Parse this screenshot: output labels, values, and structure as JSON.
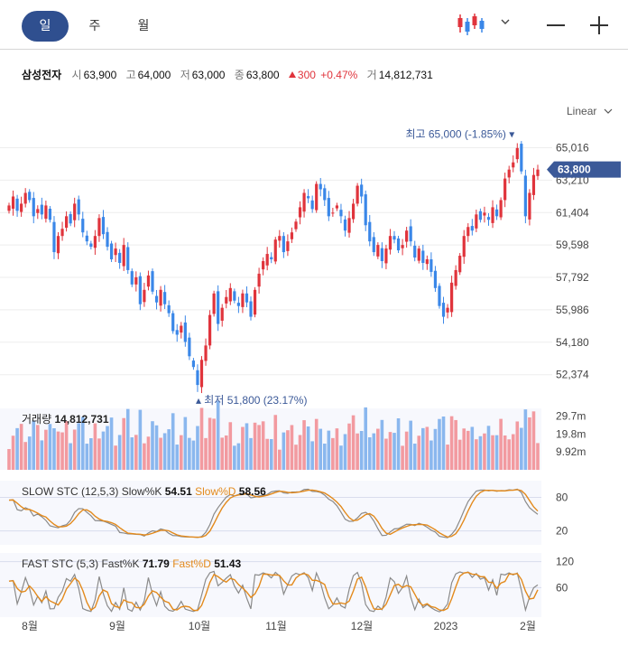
{
  "toolbar": {
    "periods": [
      "일",
      "주",
      "월"
    ],
    "active_period": "일",
    "chart_type_icon": "candlestick-icon",
    "dropdown_icon": "chevron-down-icon",
    "zoom_out_icon": "minus-icon",
    "zoom_in_icon": "plus-icon"
  },
  "info": {
    "name": "삼성전자",
    "open_label": "시",
    "open": "63,900",
    "high_label": "고",
    "high": "64,000",
    "low_label": "저",
    "low": "63,000",
    "close_label": "종",
    "close": "63,800",
    "change": "300",
    "change_pct": "+0.47%",
    "volume_label": "거",
    "volume": "14,812,731"
  },
  "scale_label": "Linear",
  "colors": {
    "up": "#e0343c",
    "down": "#3a87e8",
    "accent": "#3b5998",
    "slow_d": "#e38a1c",
    "k_line": "#8a8a8a"
  },
  "chart_data": {
    "type": "candlestick",
    "price_axis": {
      "ticks": [
        65016,
        63210,
        61404,
        59598,
        57792,
        55986,
        54180,
        52374
      ],
      "tick_labels": [
        "65,016",
        "63,210",
        "61,404",
        "59,598",
        "57,792",
        "55,986",
        "54,180",
        "52,374"
      ],
      "ylim": [
        51100,
        66200
      ]
    },
    "current_price_label": "63,800",
    "current_price": 63800,
    "high_annotation": "최고 65,000 (-1.85%)",
    "low_annotation": "최저 51,800 (23.17%)",
    "x_labels": [
      "8월",
      "9월",
      "10월",
      "11월",
      "12월",
      "2023",
      "2월"
    ],
    "closes": [
      61800,
      62300,
      61500,
      61900,
      62500,
      62100,
      61200,
      61600,
      61300,
      61800,
      61000,
      59200,
      60100,
      60500,
      61200,
      60800,
      61900,
      61300,
      60300,
      59800,
      59500,
      60100,
      61100,
      60200,
      59500,
      58800,
      59400,
      58600,
      59600,
      58200,
      57400,
      57800,
      56300,
      57100,
      57900,
      57000,
      56400,
      57100,
      56300,
      55800,
      54800,
      54600,
      55100,
      54200,
      53400,
      52800,
      51800,
      53200,
      54000,
      55700,
      56900,
      55200,
      56100,
      56700,
      57200,
      56500,
      56200,
      56900,
      56400,
      55600,
      57100,
      58000,
      58700,
      59100,
      58800,
      59900,
      60100,
      59200,
      59800,
      60300,
      60900,
      61700,
      62500,
      62200,
      61600,
      63000,
      62700,
      62100,
      61200,
      61400,
      61800,
      61200,
      60400,
      61100,
      61900,
      62900,
      62300,
      60700,
      59800,
      59200,
      59600,
      58700,
      59400,
      60100,
      59900,
      59300,
      59600,
      60400,
      59800,
      58900,
      59400,
      58600,
      58800,
      58100,
      57200,
      56200,
      55600,
      56100,
      57500,
      58200,
      59000,
      60100,
      60600,
      60400,
      61300,
      61000,
      61400,
      61000,
      61700,
      61200,
      62100,
      63300,
      63800,
      64200,
      65000,
      63700,
      61200,
      62500,
      63500,
      63800
    ],
    "volume_panel": {
      "label": "거래량",
      "value": "14,812,731",
      "tick_labels": [
        "29.7m",
        "19.8m",
        "9.92m"
      ],
      "ticks": [
        29.7,
        19.8,
        9.92
      ],
      "ylim": [
        0,
        34
      ]
    },
    "slow_stc": {
      "label": "SLOW STC (12,5,3)",
      "k_label": "Slow%K",
      "k_value": "54.51",
      "d_label": "Slow%D",
      "d_value": "58.56",
      "tick_labels": [
        "80",
        "20"
      ],
      "ticks": [
        80,
        20
      ],
      "ylim": [
        -5,
        110
      ]
    },
    "fast_stc": {
      "label": "FAST STC (5,3)",
      "k_label": "Fast%K",
      "k_value": "71.79",
      "d_label": "Fast%D",
      "d_value": "51.43",
      "tick_labels": [
        "120",
        "60"
      ],
      "ticks": [
        120,
        60
      ],
      "ylim": [
        -8,
        140
      ]
    }
  }
}
